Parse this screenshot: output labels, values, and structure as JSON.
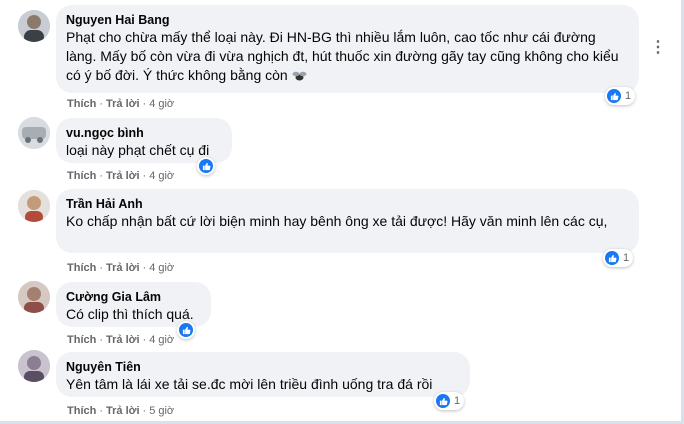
{
  "ui": {
    "like_label": "Thích",
    "reply_label": "Trả lời",
    "separator": "·",
    "more_options": "⋮"
  },
  "comments": [
    {
      "name": "Nguyen Hai Bang",
      "text": "Phạt cho chừa mấy thể loại này. Đi HN-BG thì nhiều lắm luôn, cao tốc như cái đường làng. Mấy bố còn vừa đi vừa nghịch đt, hút thuốc xin đường gãy tay cũng không cho kiểu có ý bố đời. Ý thức không bằng còn",
      "time": "4 giờ",
      "reactions": "1"
    },
    {
      "name": "vu.ngọc bình",
      "text": "loại này phạt chết cụ đi",
      "time": "4 giờ",
      "reactions": ""
    },
    {
      "name": "Trần Hải Anh",
      "text": "Ko chấp nhận bất cứ lời biện minh hay bênh ông xe tải được! Hãy văn minh lên các cụ,",
      "time": "4 giờ",
      "reactions": "1"
    },
    {
      "name": "Cường Gia Lâm",
      "text": "Có clip thì thích quá.",
      "time": "4 giờ",
      "reactions": ""
    },
    {
      "name": "Nguyên Tiên",
      "text": "Yên tâm là lái xe tải se.đc mời lên triều đình uống tra đá rồi",
      "time": "5 giờ",
      "reactions": "1"
    }
  ]
}
